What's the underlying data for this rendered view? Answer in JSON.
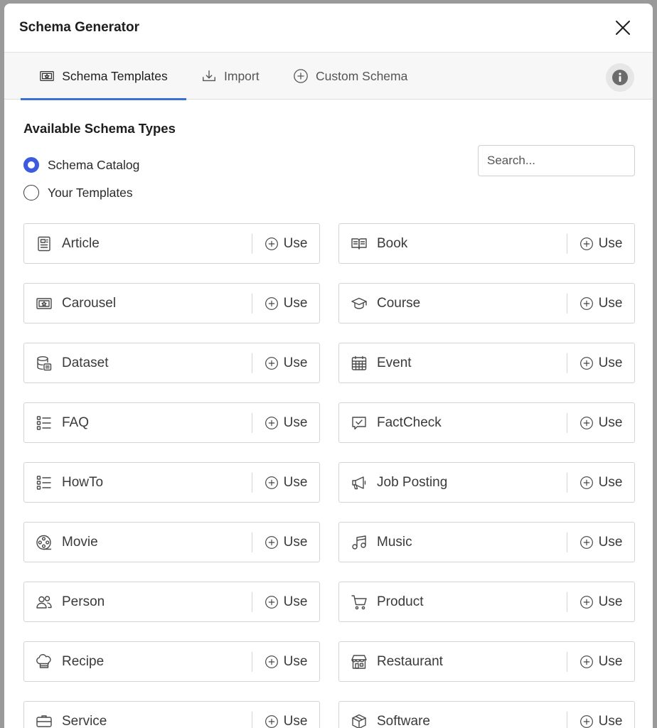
{
  "dialog": {
    "title": "Schema Generator"
  },
  "tabs": [
    {
      "label": "Schema Templates",
      "icon": "carousel-icon",
      "active": true
    },
    {
      "label": "Import",
      "icon": "import-icon",
      "active": false
    },
    {
      "label": "Custom Schema",
      "icon": "plus-circle-icon",
      "active": false
    }
  ],
  "section": {
    "title": "Available Schema Types"
  },
  "source_options": [
    {
      "label": "Schema Catalog",
      "checked": true
    },
    {
      "label": "Your Templates",
      "checked": false
    }
  ],
  "search": {
    "placeholder": "Search...",
    "value": ""
  },
  "use_label": "Use",
  "accent_color": "#3d5be0",
  "schemas": [
    {
      "name": "Article",
      "icon": "article-icon"
    },
    {
      "name": "Book",
      "icon": "book-icon"
    },
    {
      "name": "Carousel",
      "icon": "carousel-icon"
    },
    {
      "name": "Course",
      "icon": "graduation-cap-icon"
    },
    {
      "name": "Dataset",
      "icon": "database-icon"
    },
    {
      "name": "Event",
      "icon": "calendar-icon"
    },
    {
      "name": "FAQ",
      "icon": "list-icon"
    },
    {
      "name": "FactCheck",
      "icon": "check-message-icon"
    },
    {
      "name": "HowTo",
      "icon": "list-icon"
    },
    {
      "name": "Job Posting",
      "icon": "megaphone-icon"
    },
    {
      "name": "Movie",
      "icon": "film-reel-icon"
    },
    {
      "name": "Music",
      "icon": "music-note-icon"
    },
    {
      "name": "Person",
      "icon": "people-icon"
    },
    {
      "name": "Product",
      "icon": "cart-icon"
    },
    {
      "name": "Recipe",
      "icon": "chef-hat-icon"
    },
    {
      "name": "Restaurant",
      "icon": "store-icon"
    },
    {
      "name": "Service",
      "icon": "service-icon"
    },
    {
      "name": "Software",
      "icon": "box-icon"
    }
  ]
}
